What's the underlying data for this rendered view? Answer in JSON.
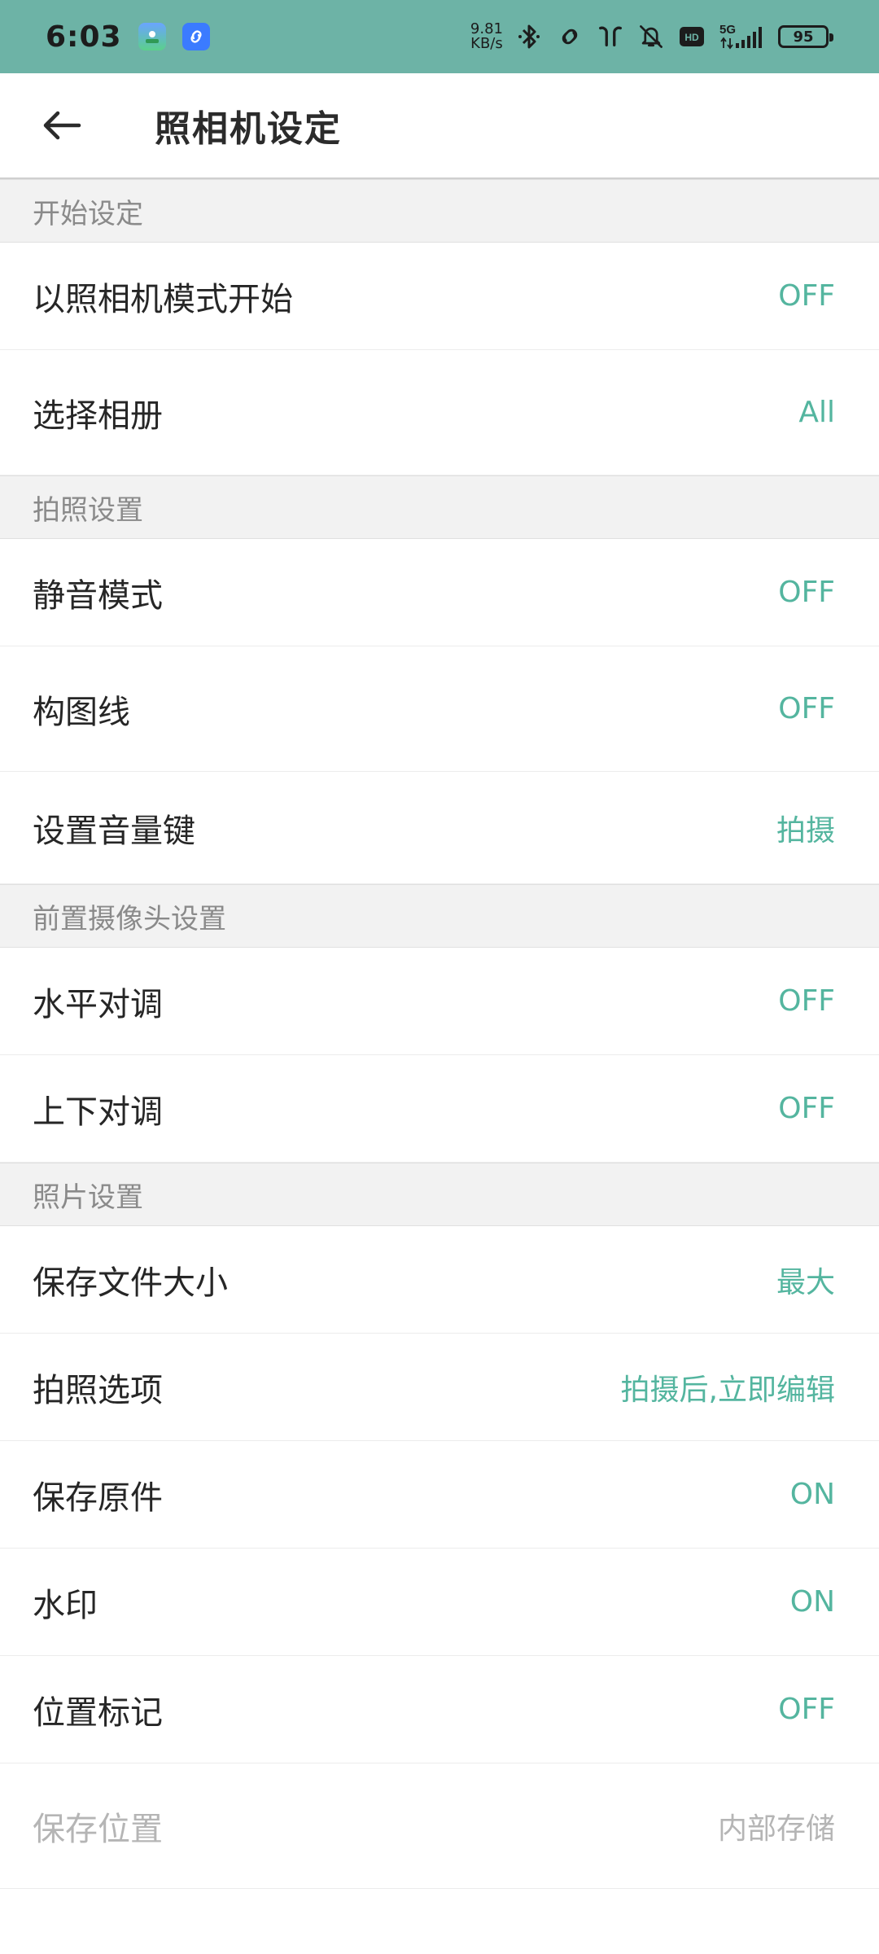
{
  "status_bar": {
    "time": "6:03",
    "net_speed_value": "9.81",
    "net_speed_unit": "KB/s",
    "network": "5G",
    "battery": "95",
    "hd_label": "HD"
  },
  "header": {
    "title": "照相机设定"
  },
  "sections": [
    {
      "title": "开始设定",
      "rows": [
        {
          "label": "以照相机模式开始",
          "value": "OFF"
        },
        {
          "label": "选择相册",
          "value": "All"
        }
      ]
    },
    {
      "title": "拍照设置",
      "rows": [
        {
          "label": "静音模式",
          "value": "OFF"
        },
        {
          "label": "构图线",
          "value": "OFF"
        },
        {
          "label": "设置音量键",
          "value": "拍摄"
        }
      ]
    },
    {
      "title": "前置摄像头设置",
      "rows": [
        {
          "label": "水平对调",
          "value": "OFF"
        },
        {
          "label": "上下对调",
          "value": "OFF"
        }
      ]
    },
    {
      "title": "照片设置",
      "rows": [
        {
          "label": "保存文件大小",
          "value": "最大"
        },
        {
          "label": "拍照选项",
          "value": "拍摄后,立即编辑"
        },
        {
          "label": "保存原件",
          "value": "ON"
        },
        {
          "label": "水印",
          "value": "ON"
        },
        {
          "label": "位置标记",
          "value": "OFF"
        },
        {
          "label": "保存位置",
          "value": "内部存储"
        }
      ]
    }
  ],
  "colors": {
    "status_bar": "#6db3a6",
    "accent_value": "#54b59f",
    "section_bg": "#f2f2f2",
    "disabled_text": "#b5b5b5"
  }
}
